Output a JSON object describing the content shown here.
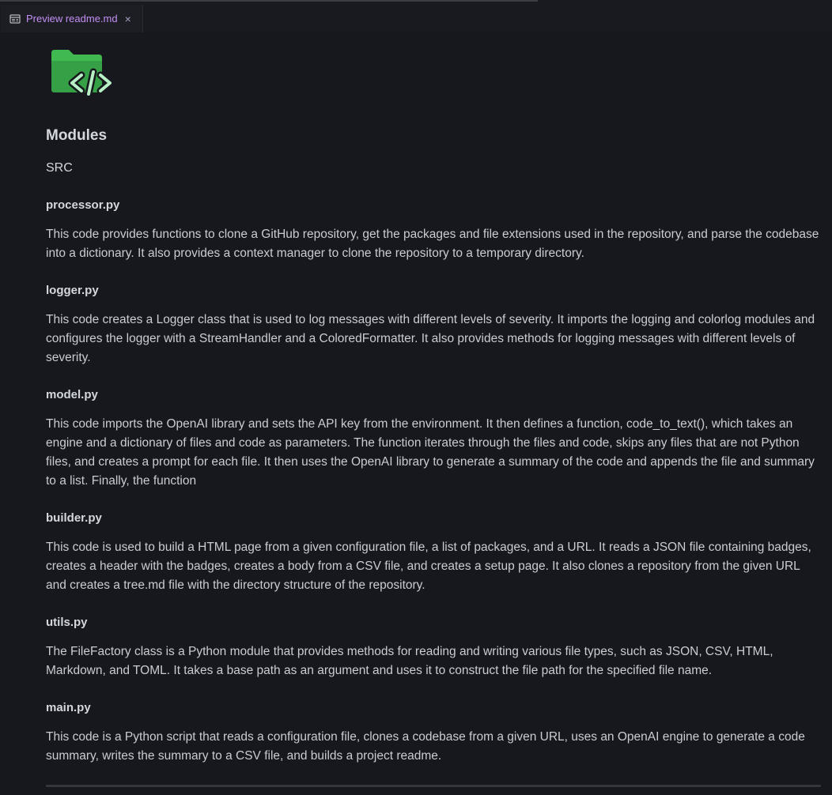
{
  "tab": {
    "label": "Preview readme.md",
    "close": "×",
    "icon": "preview-icon"
  },
  "logo": {
    "icon": "code-folder-icon",
    "color": "#3fb950"
  },
  "heading": "Modules",
  "section": "SRC",
  "modules": [
    {
      "name": "processor.py",
      "description": "This code provides functions to clone a GitHub repository, get the packages and file extensions used in the repository, and parse the codebase into a dictionary. It also provides a context manager to clone the repository to a temporary directory."
    },
    {
      "name": "logger.py",
      "description": "This code creates a Logger class that is used to log messages with different levels of severity. It imports the logging and colorlog modules and configures the logger with a StreamHandler and a ColoredFormatter. It also provides methods for logging messages with different levels of severity."
    },
    {
      "name": "model.py",
      "description": "This code imports the OpenAI library and sets the API key from the environment. It then defines a function, code_to_text(), which takes an engine and a dictionary of files and code as parameters. The function iterates through the files and code, skips any files that are not Python files, and creates a prompt for each file. It then uses the OpenAI library to generate a summary of the code and appends the file and summary to a list. Finally, the function"
    },
    {
      "name": "builder.py",
      "description": "This code is used to build a HTML page from a given configuration file, a list of packages, and a URL. It reads a JSON file containing badges, creates a header with the badges, creates a body from a CSV file, and creates a setup page. It also clones a repository from the given URL and creates a tree.md file with the directory structure of the repository."
    },
    {
      "name": "utils.py",
      "description": "The FileFactory class is a Python module that provides methods for reading and writing various file types, such as JSON, CSV, HTML, Markdown, and TOML. It takes a base path as an argument and uses it to construct the file path for the specified file name."
    },
    {
      "name": "main.py",
      "description": "This code is a Python script that reads a configuration file, clones a codebase from a given URL, uses an OpenAI engine to generate a code summary, writes the summary to a CSV file, and builds a project readme."
    }
  ]
}
